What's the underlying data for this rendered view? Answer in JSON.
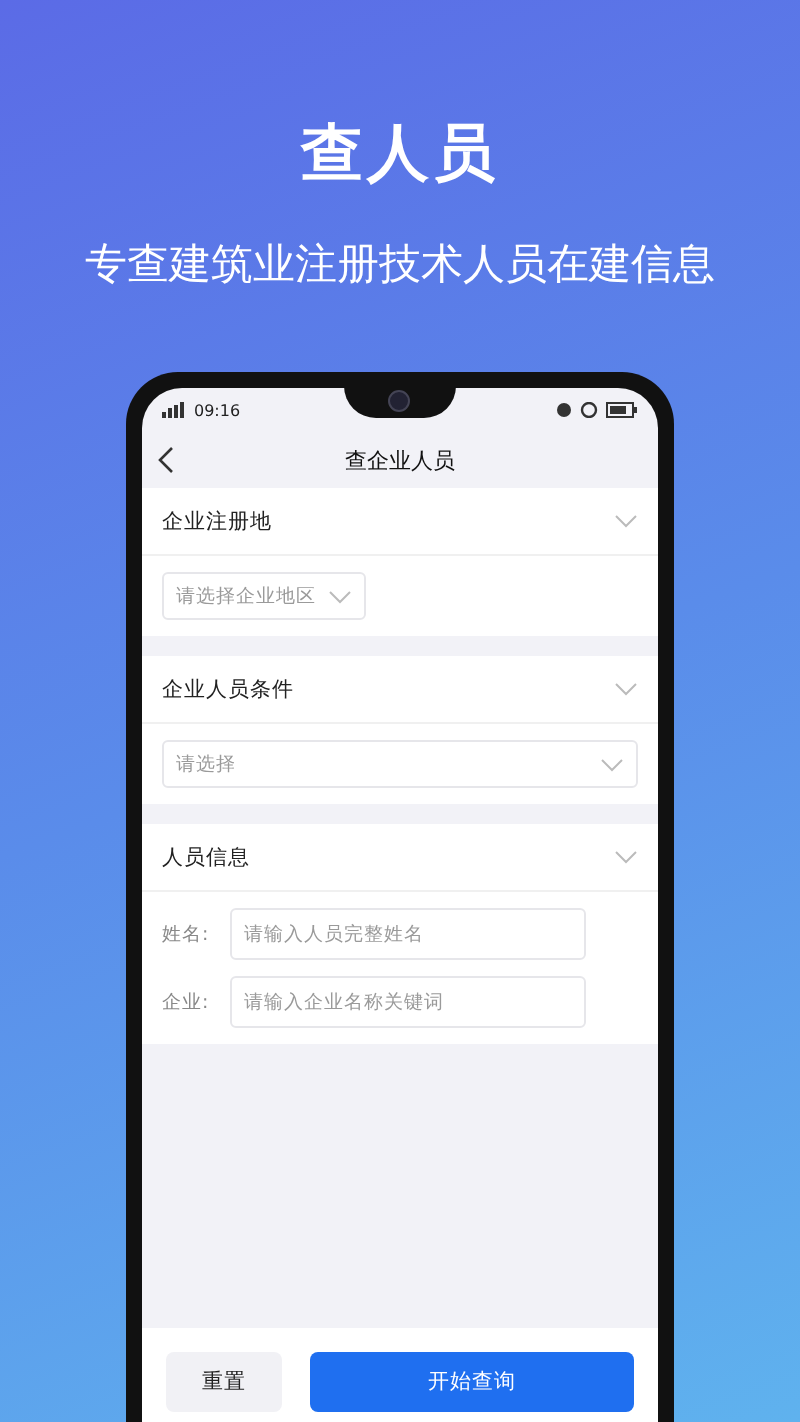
{
  "header": {
    "title": "查人员",
    "subtitle": "专查建筑业注册技术人员在建信息"
  },
  "status_bar": {
    "time": "09:16"
  },
  "nav": {
    "title": "查企业人员"
  },
  "sections": [
    {
      "title": "企业注册地",
      "fields": [
        {
          "kind": "region",
          "placeholder": "请选择企业地区"
        }
      ]
    },
    {
      "title": "企业人员条件",
      "fields": [
        {
          "kind": "select",
          "placeholder": "请选择"
        }
      ]
    },
    {
      "title": "人员信息",
      "fields": [
        {
          "kind": "input",
          "label": "姓名:",
          "placeholder": "请输入人员完整姓名"
        },
        {
          "kind": "input",
          "label": "企业:",
          "placeholder": "请输入企业名称关键词"
        }
      ]
    }
  ],
  "buttons": [
    {
      "kind": "secondary",
      "label": "重置"
    },
    {
      "kind": "primary",
      "label": "开始查询"
    }
  ]
}
